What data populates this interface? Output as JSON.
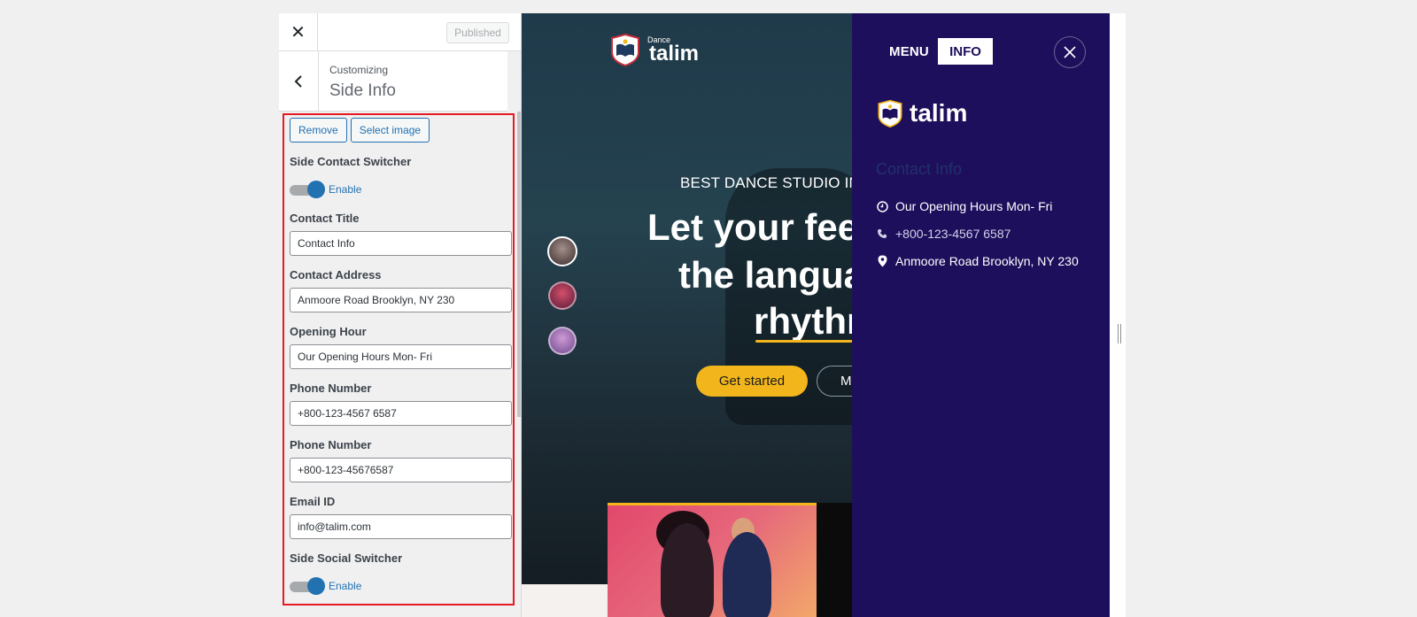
{
  "customizer": {
    "close_symbol": "✕",
    "published_label": "Published",
    "customizing_label": "Customizing",
    "section_title": "Side Info",
    "remove_label": "Remove",
    "select_image_label": "Select image",
    "side_contact_switcher_label": "Side Contact Switcher",
    "contact_toggle_text": "Enable",
    "contact_title_label": "Contact Title",
    "contact_title_value": "Contact Info",
    "contact_address_label": "Contact Address",
    "contact_address_value": "Anmoore Road Brooklyn, NY 230",
    "opening_hour_label": "Opening Hour",
    "opening_hour_value": "Our Opening Hours Mon- Fri",
    "phone_number_label_1": "Phone Number",
    "phone_number_value_1": "+800-123-4567 6587",
    "phone_number_label_2": "Phone Number",
    "phone_number_value_2": "+800-123-45676587",
    "email_label": "Email ID",
    "email_value": "info@talim.com",
    "side_social_switcher_label": "Side Social Switcher",
    "social_toggle_text": "Enable"
  },
  "preview": {
    "logo_small": "Dance",
    "logo_text": "talim",
    "hero_subtitle": "BEST DANCE STUDIO IN",
    "hero_line_1": "Let your fee",
    "hero_line_2": "the langua",
    "hero_line_3": "rhythr",
    "get_started_label": "Get started",
    "more_label": "Mo"
  },
  "side_info": {
    "menu_tab": "MENU",
    "info_tab": "INFO",
    "logo_text": "talim",
    "contact_title": "Contact Info",
    "opening_hours": "Our Opening Hours Mon- Fri",
    "phone": "+800-123-4567 6587",
    "address": "Anmoore Road Brooklyn, NY 230"
  },
  "colors": {
    "wp_blue": "#2271b1",
    "highlight_red": "#e51b23",
    "panel_purple": "#1e0f5c",
    "accent_yellow": "#f2b61c"
  },
  "icons": [
    "close-icon",
    "back-chevron-icon",
    "clock-icon",
    "phone-icon",
    "location-pin-icon",
    "talim-logo-icon"
  ]
}
